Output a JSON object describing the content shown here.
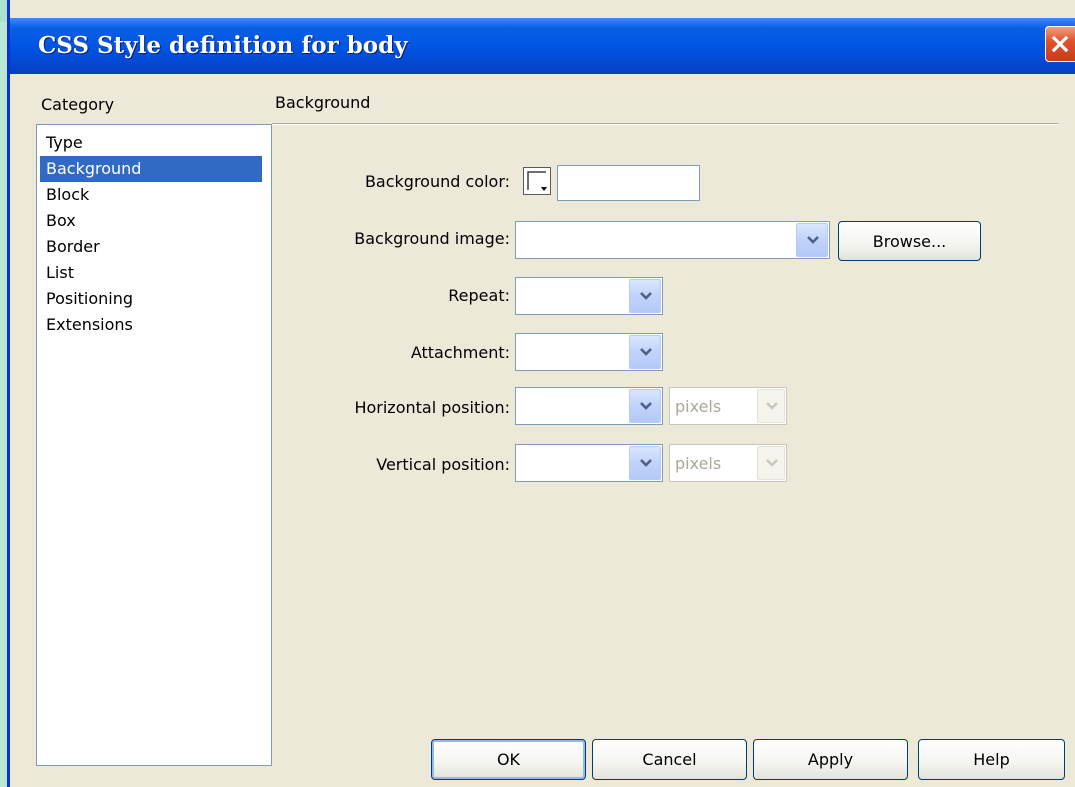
{
  "window": {
    "title": "CSS Style definition for body"
  },
  "category": {
    "label": "Category",
    "items": [
      "Type",
      "Background",
      "Block",
      "Box",
      "Border",
      "List",
      "Positioning",
      "Extensions"
    ],
    "selected": "Background"
  },
  "section": {
    "title": "Background"
  },
  "fields": {
    "background_color": {
      "label": "Background color:",
      "value": ""
    },
    "background_image": {
      "label": "Background image:",
      "value": "",
      "browse_label": "Browse..."
    },
    "repeat": {
      "label": "Repeat:",
      "value": ""
    },
    "attachment": {
      "label": "Attachment:",
      "value": ""
    },
    "horizontal_position": {
      "label": "Horizontal position:",
      "value": "",
      "unit": "pixels"
    },
    "vertical_position": {
      "label": "Vertical position:",
      "value": "",
      "unit": "pixels"
    }
  },
  "buttons": {
    "ok": "OK",
    "cancel": "Cancel",
    "apply": "Apply",
    "help": "Help"
  },
  "icons": {
    "close": "close-icon",
    "dropdown": "chevron-down-icon",
    "color_picker": "color-swatch-icon"
  },
  "colors": {
    "titlebar": "#0053e1",
    "selection": "#316ac5",
    "dialog_bg": "#ece9d8",
    "close_button": "#e0532e"
  }
}
